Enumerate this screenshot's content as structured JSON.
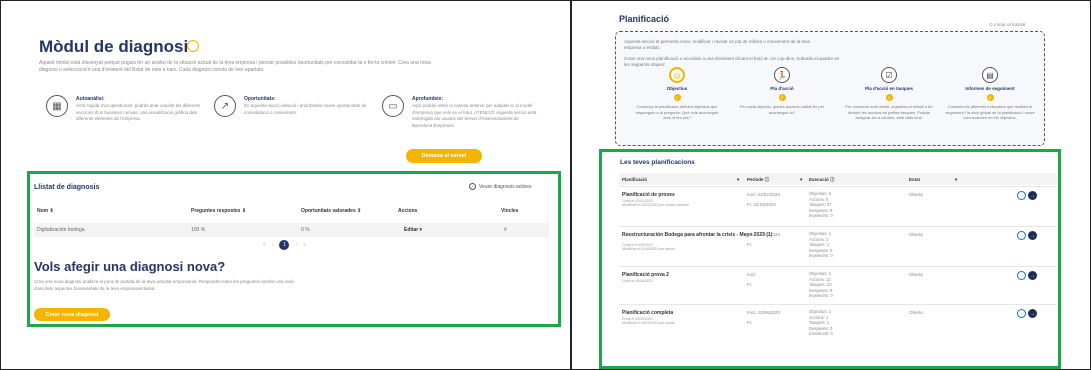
{
  "left": {
    "title": "Mòdul de diagnosi",
    "intro": "Aquest mòdul està dissenyat perquè puguis fer un anàlisi de la situació actual de la teva empresa i pensar possibles oportunitats per consolidar-la o fer-la créixer. Crea una nova diagnosi o selecciona'n una d'existent del llistat de més a baix. Cada diagnosi consta de tres apartats:",
    "features": [
      {
        "icon": "grid-icon",
        "title": "Autoanàlisi:",
        "desc": "Amb l'ajuda d'un qüestionari, podràs anar omplint les diferents seccions d'un business canvas, una visualització gràfica dels diferents elements de l'empresa."
      },
      {
        "icon": "growth-chart-icon",
        "title": "Oportunitats:",
        "desc": "En aquesta secció ideació i prioritzaràs noves oportunitats de consolidació o creixement."
      },
      {
        "icon": "monitor-icon",
        "title": "Aprofundeix:",
        "desc": "Aquí podràs rebre el canvas anterior per adaptar-lo al model d'empresa que vols en el futur. ATENCIÓ: Aquesta secció està restringida als usuaris del Servei d'Assessorament de Barcelona Empreses."
      }
    ],
    "demana_button": "Demana el servei",
    "list": {
      "title": "Llistat de diagnosis",
      "active_toggle": "Veure diagnosis actives",
      "columns": [
        "Nom ⇕",
        "Preguntes respostes ⇕",
        "Oportunitats valorades ⇕",
        "Accions",
        "Vincles"
      ],
      "rows": [
        {
          "nom": "Digitalización bodega",
          "preguntes": "100 %",
          "oportunitats": "0 %",
          "accions": "Editar ▾",
          "vincles": "#"
        }
      ],
      "pager": {
        "first": "«",
        "prev": "‹",
        "current": "1",
        "next": "›",
        "last": "»"
      }
    },
    "new": {
      "title": "Vols afegir una diagnosi nova?",
      "desc": "Crea una nova diagnosi analitza el punt de partida de la teva activitat empresarial. Respondre totes les preguntes tindràs una visió clara dels aspectes fonamentals de la teva empresa/activitat.",
      "button": "Crear nova diagnosi"
    }
  },
  "right": {
    "title": "Planificació",
    "tutorial": "⊙ Iniciar el tutorial",
    "intro1": "Aquesta secció et permetrà crear, modificar i revisar un pla de millora o creixement de la teva empresa o entitat.",
    "intro2": "Crear una nova planificació o accedeix a una d'existent clicant el botó ⊕. Un cop dins, trobaràs el quadre en les següents etapes:",
    "steps": [
      {
        "icon": "target-icon",
        "title": "Objectius",
        "num": "1",
        "desc": "Comença la planificació definint objectius que responguin a la pregunta: Què vols aconseguir amb el teu pla?"
      },
      {
        "icon": "running-person-icon",
        "title": "Pla d'acció",
        "num": "2",
        "desc": "Per cada objectiu, quines accions caldrà fer per aconseguir-lo?"
      },
      {
        "icon": "checklist-icon",
        "title": "Pla d'acció en tasques",
        "num": "3",
        "desc": "Per concretar amb detall, organitza el treball a fer dividint les accions en petites tasques. Podràs assignar-les a usuaris, amb data límit."
      },
      {
        "icon": "report-icon",
        "title": "Informes de seguiment",
        "num": "4",
        "desc": "Consulta els diferents indicadors que faciliten el seguiment i la visió global de la planificació i veure com avances en els objectius."
      }
    ],
    "plans": {
      "title": "Les teves planificacions",
      "columns": [
        "Planificació",
        "▾",
        "Període ⓘ",
        "▾",
        "Execució ⓘ",
        "Estat",
        "▾"
      ],
      "rows": [
        {
          "name": "Planificació de proves",
          "sub1": "Creat el 01/01/2023",
          "sub2": "Modificat el 20/10/2023 per usuari contacte",
          "per1": "Inici: 01/02/2023",
          "per2": "Fi: 31/10/2023",
          "exec": [
            "Objectius: 6",
            "Accions: 9",
            "Tasques: 37",
            "Despeses: 9",
            "Inversions: 0"
          ],
          "stat": "Oberta"
        },
        {
          "name": "Reestructuración Bodega para afrontar la crisis - Mayo 2023 (1)",
          "sub1": "Creat el 01/05/2023",
          "sub2": "Modificat el 01/05/2023 per admin",
          "per1": "Inici: 17/05/2023",
          "per2": "Fi:",
          "exec": [
            "Objectius: 1",
            "Accions: 1",
            "Tasques: 1",
            "Despeses: 0",
            "Inversions: 0"
          ],
          "stat": "Oberta"
        },
        {
          "name": "Planificació prova 2",
          "sub1": "Creat el 06/06/2023",
          "sub2": "",
          "per1": "Inici:",
          "per2": "Fi:",
          "exec": [
            "Objectius: 1",
            "Accions: 12",
            "Tasques: 23",
            "Despeses: 9",
            "Inversions: 0"
          ],
          "stat": "Oberta"
        },
        {
          "name": "Planificació completa",
          "sub1": "Creat el 03/03/2023",
          "sub2": "Modificat el 03/03/2023 per usuari",
          "per1": "Inici: 22/06/2023",
          "per2": "Fi:",
          "exec": [
            "Objectius: 1",
            "Accions: 1",
            "Tasques: 1",
            "Despeses: 0",
            "Inversions: 0"
          ],
          "stat": "Oberta"
        }
      ]
    }
  },
  "colors": {
    "accent": "#f4b400",
    "brand": "#25356a",
    "highlight": "#1aa84a"
  }
}
